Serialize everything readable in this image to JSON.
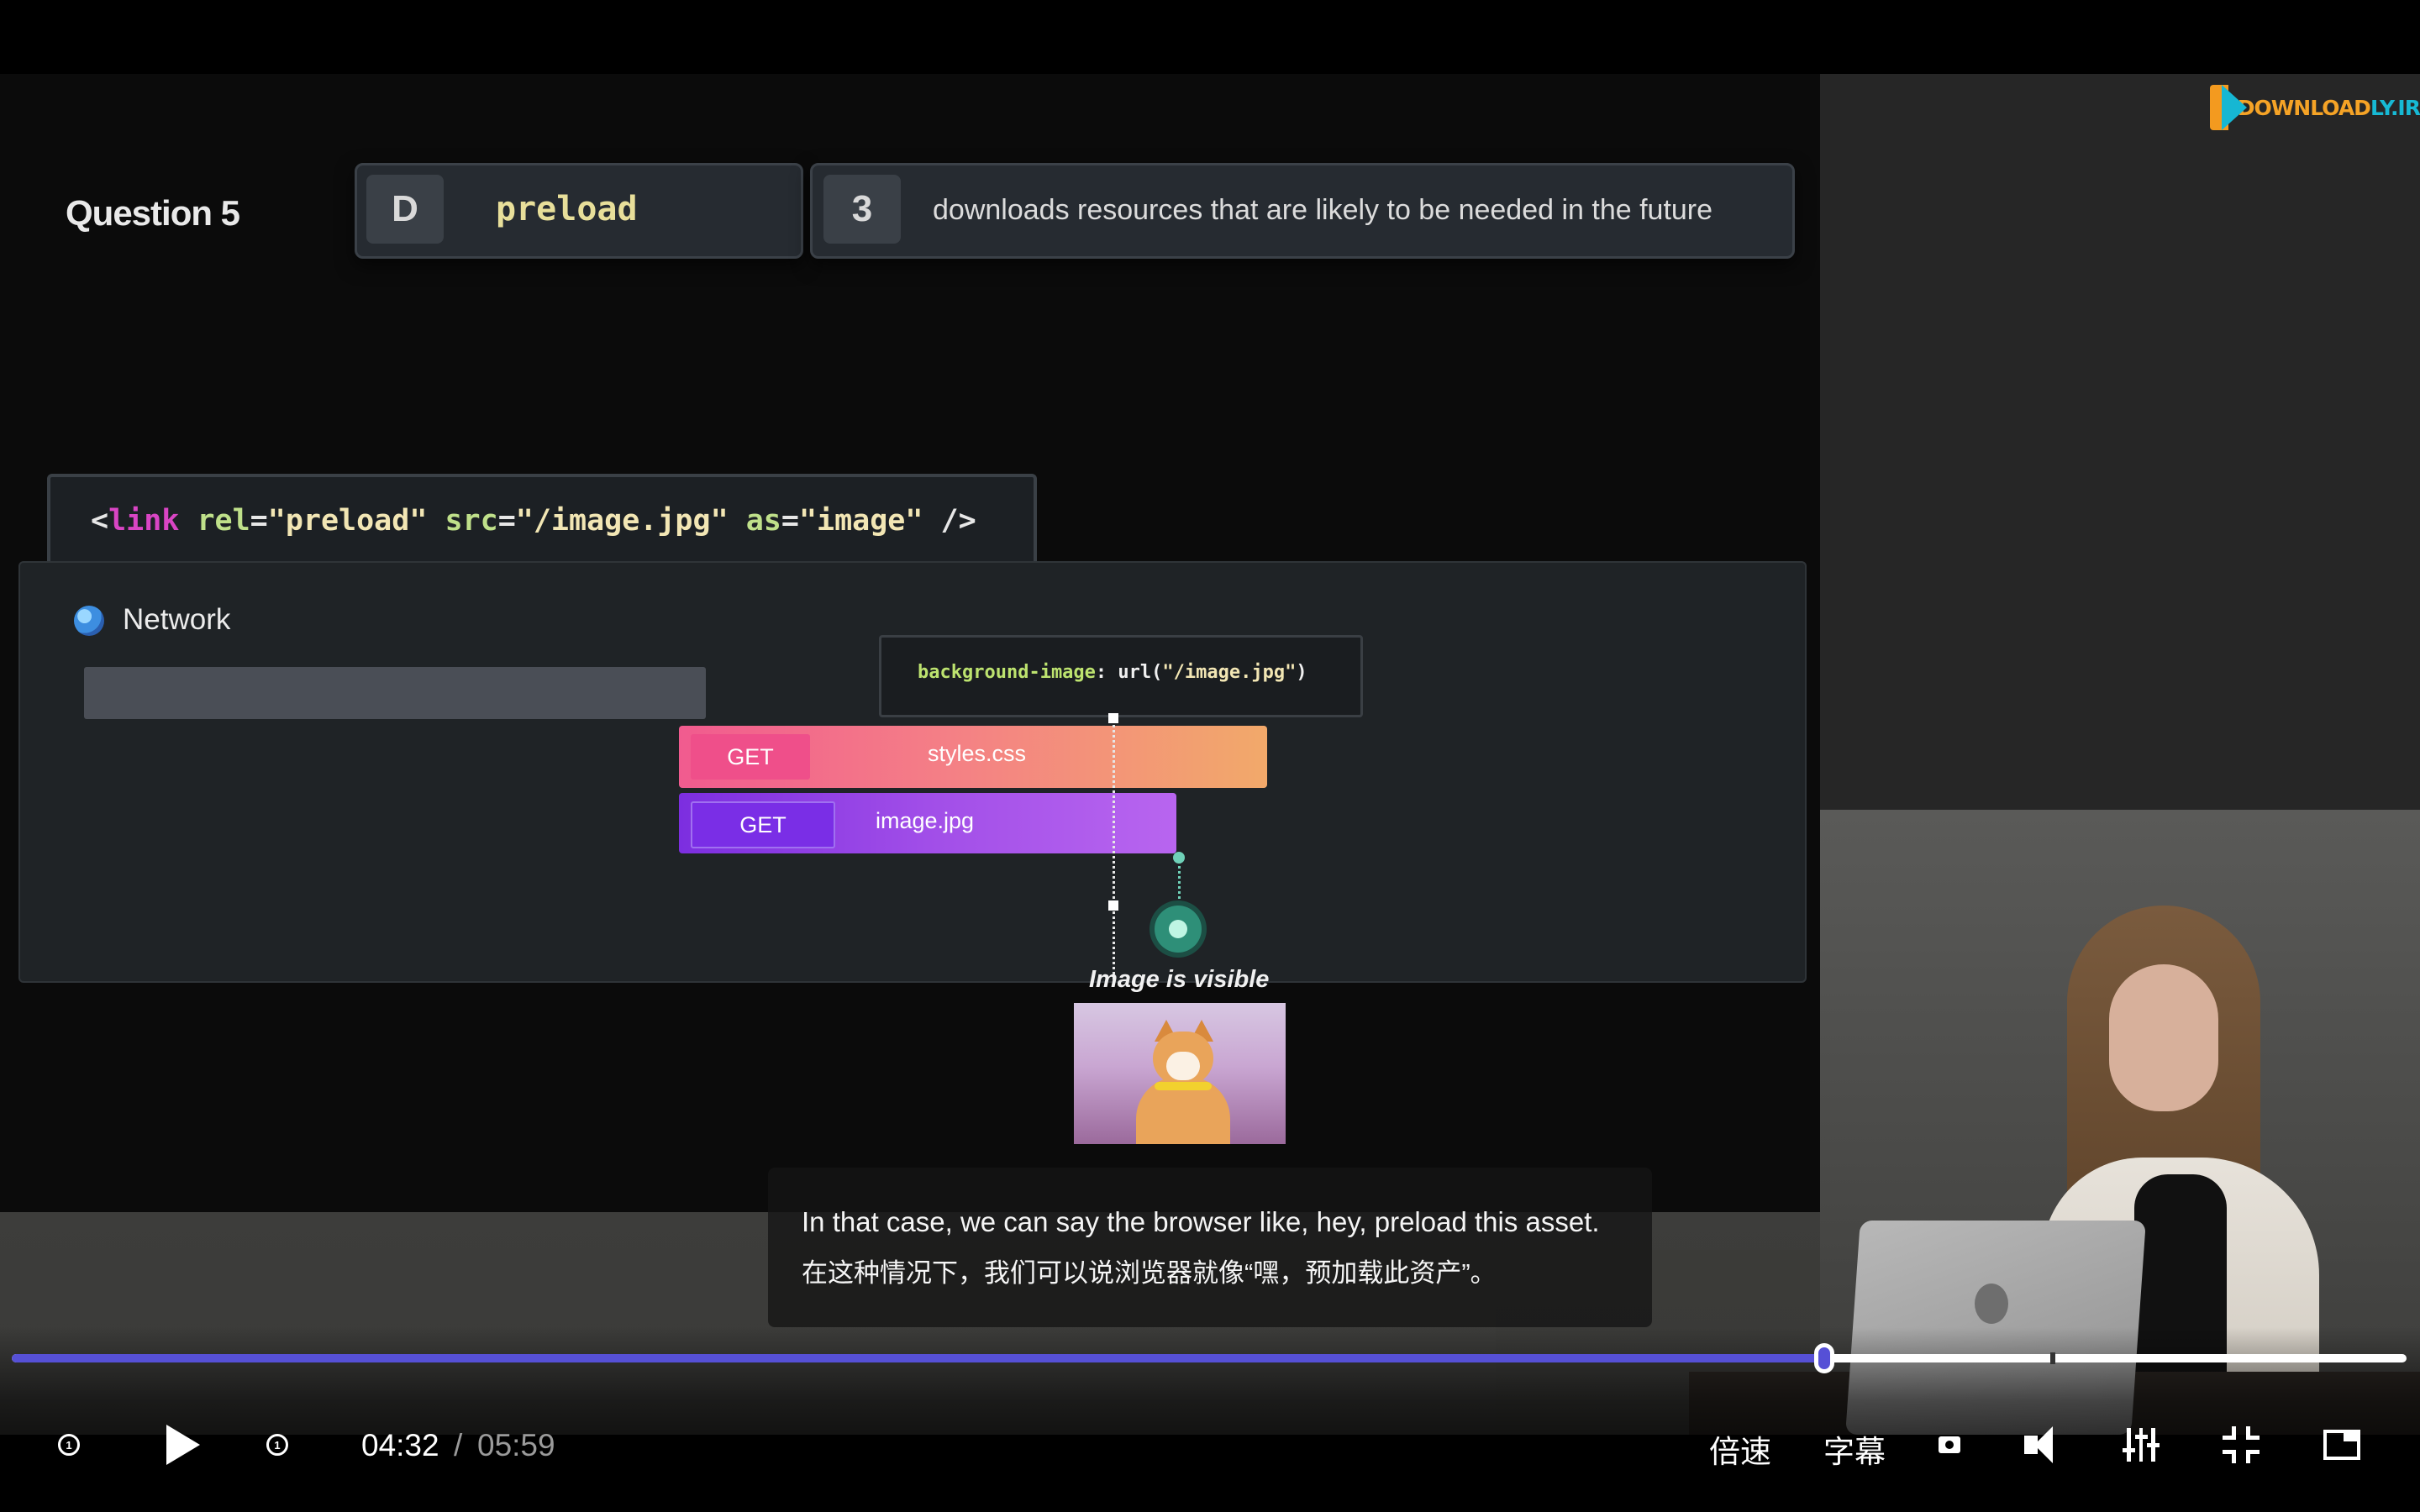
{
  "brand": {
    "logo_text_a": "DOWNLOAD",
    "logo_text_b": "LY.IR"
  },
  "slide": {
    "question_title": "Question 5",
    "answer": {
      "letter": "D",
      "text": "preload"
    },
    "definition": {
      "number": "3",
      "text": "downloads resources that are likely to be needed in the future"
    },
    "code": {
      "open": "<",
      "tag": "link",
      "attr1": " rel",
      "eq1": "=",
      "val1": "\"preload\"",
      "attr2": " src",
      "eq2": "=",
      "val2": "\"/image.jpg\"",
      "attr3": " as",
      "eq3": "=",
      "val3": "\"image\"",
      "close": " />"
    },
    "network": {
      "label": "Network",
      "css_tooltip": {
        "prop": "background-image",
        "colon": ": url(",
        "value": "\"/image.jpg\"",
        "end": ")"
      },
      "requests": [
        {
          "method": "GET",
          "file": "styles.css"
        },
        {
          "method": "GET",
          "file": "image.jpg"
        }
      ],
      "visible_label": "Image is visible"
    }
  },
  "subtitles": {
    "en": "In that case, we can say the browser like, hey, preload this asset.",
    "zh": "在这种情况下，我们可以说浏览器就像“嘿，预加载此资产”。"
  },
  "player": {
    "progress_fraction": 0.757,
    "time_current": "04:32",
    "time_separator": "/",
    "time_total": "05:59",
    "rewind_label": "1",
    "forward_label": "1",
    "speed_label": "倍速",
    "subtitle_label": "字幕",
    "accent_color": "#5650d6"
  }
}
